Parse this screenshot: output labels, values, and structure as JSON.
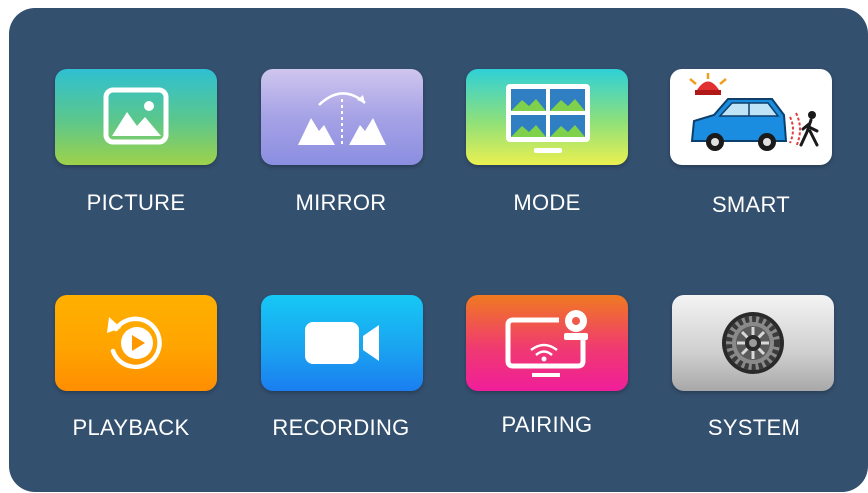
{
  "menu": {
    "items": [
      {
        "label": "PICTURE",
        "icon": "picture-icon"
      },
      {
        "label": "MIRROR",
        "icon": "mirror-icon"
      },
      {
        "label": "MODE",
        "icon": "mode-icon"
      },
      {
        "label": "SMART",
        "icon": "smart-icon"
      },
      {
        "label": "PLAYBACK",
        "icon": "playback-icon"
      },
      {
        "label": "RECORDING",
        "icon": "recording-icon"
      },
      {
        "label": "PAIRING",
        "icon": "pairing-icon"
      },
      {
        "label": "SYSTEM",
        "icon": "system-icon"
      }
    ]
  },
  "colors": {
    "panel_background": "#34506f",
    "label_text": "#ffffff"
  }
}
